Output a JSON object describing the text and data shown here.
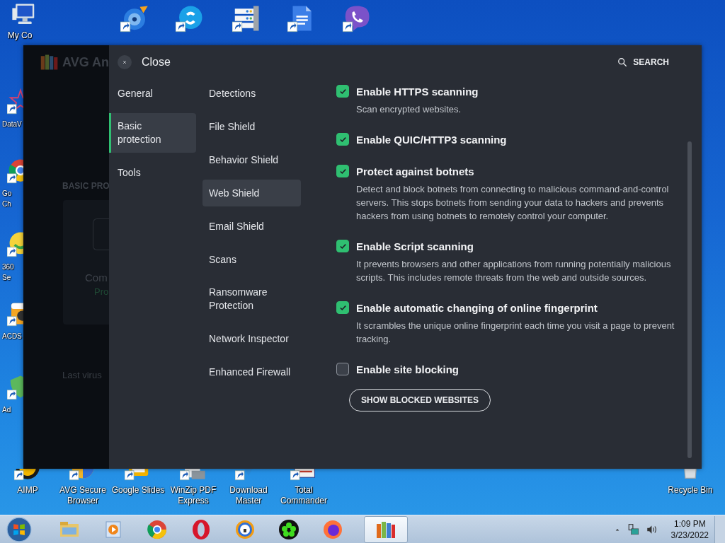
{
  "desktop_icons": [
    {
      "label": "My Co"
    },
    {
      "label": "DataV"
    },
    {
      "label": "Go Ch"
    },
    {
      "label": "360 Se"
    },
    {
      "label": "ACDS"
    },
    {
      "label": "Ad"
    },
    {
      "label": "AIMP"
    },
    {
      "label": "AVG Secure Browser"
    },
    {
      "label": "Google Slides"
    },
    {
      "label": "WinZip PDF Express"
    },
    {
      "label": "Download Master"
    },
    {
      "label": "Total Commander"
    },
    {
      "label": "Recycle Bin"
    }
  ],
  "background_window": {
    "logo_text": "AVG An",
    "section_title": "BASIC PRO",
    "status_title": "Com",
    "status_subtitle": "Pro",
    "last_scan": "Last virus"
  },
  "settings": {
    "close_label": "Close",
    "search_label": "SEARCH",
    "categories": [
      {
        "label": "General",
        "selected": false
      },
      {
        "label": "Basic protection",
        "selected": true
      },
      {
        "label": "Tools",
        "selected": false
      }
    ],
    "sections": [
      {
        "label": "Detections",
        "selected": false
      },
      {
        "label": "File Shield",
        "selected": false
      },
      {
        "label": "Behavior Shield",
        "selected": false
      },
      {
        "label": "Web Shield",
        "selected": true
      },
      {
        "label": "Email Shield",
        "selected": false
      },
      {
        "label": "Scans",
        "selected": false
      },
      {
        "label": "Ransomware Protection",
        "selected": false
      },
      {
        "label": "Network Inspector",
        "selected": false
      },
      {
        "label": "Enhanced Firewall",
        "selected": false
      }
    ],
    "options": [
      {
        "title": "Enable HTTPS scanning",
        "checked": true,
        "description": "Scan encrypted websites."
      },
      {
        "title": "Enable QUIC/HTTP3 scanning",
        "checked": true
      },
      {
        "title": "Protect against botnets",
        "checked": true,
        "description": "Detect and block botnets from connecting to malicious command-and-control servers. This stops botnets from sending your data to hackers and prevents hackers from using botnets to remotely control your computer."
      },
      {
        "title": "Enable Script scanning",
        "checked": true,
        "description": "It prevents browsers and other applications from running potentially malicious scripts. This includes remote threats from the web and outside sources."
      },
      {
        "title": "Enable automatic changing of online fingerprint",
        "checked": true,
        "description": "It scrambles the unique online fingerprint each time you visit a page to prevent tracking."
      },
      {
        "title": "Enable site blocking",
        "checked": false
      }
    ],
    "action_button": "SHOW BLOCKED WEBSITES"
  },
  "taskbar": {
    "clock_time": "1:09 PM",
    "clock_date": "3/23/2022"
  }
}
